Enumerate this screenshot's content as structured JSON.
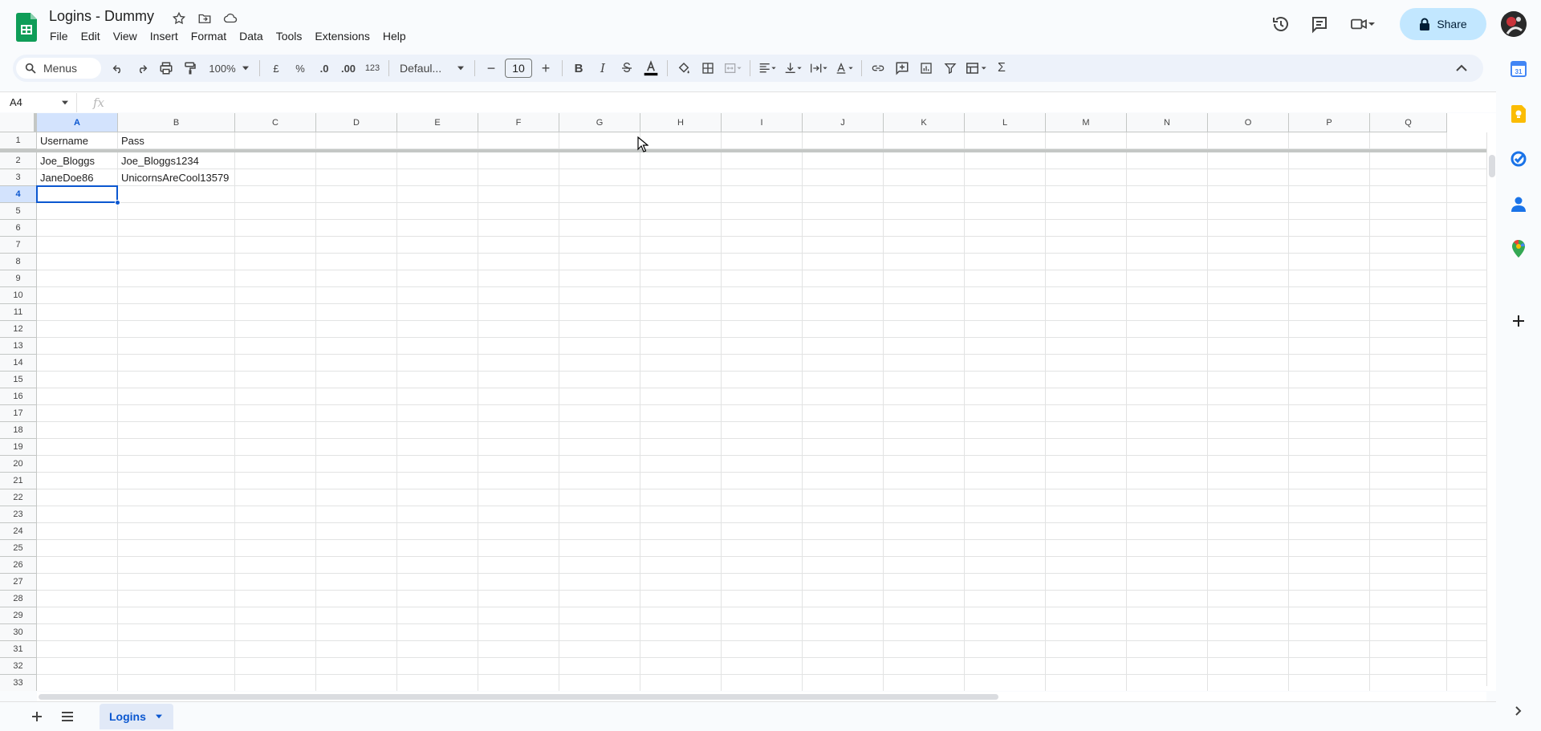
{
  "app": {
    "title": "Logins - Dummy",
    "menus": [
      "File",
      "Edit",
      "View",
      "Insert",
      "Format",
      "Data",
      "Tools",
      "Extensions",
      "Help"
    ],
    "share_label": "Share"
  },
  "toolbar": {
    "search_label": "Menus",
    "zoom": "100%",
    "currency": "£",
    "percent": "%",
    "decrease_decimal": ".0",
    "increase_decimal": ".00",
    "number_format": "123",
    "font": "Defaul...",
    "font_size": "10",
    "bold": "B",
    "italic": "I",
    "sum": "Σ"
  },
  "formula_bar": {
    "cell_ref": "A4",
    "fx": "fx",
    "value": ""
  },
  "sheet": {
    "columns": [
      "A",
      "B",
      "C",
      "D",
      "E",
      "F",
      "G",
      "H",
      "I",
      "J",
      "K",
      "L",
      "M",
      "N",
      "O",
      "P",
      "Q"
    ],
    "active_column": "A",
    "active_row": "4",
    "rows": [
      "1",
      "2",
      "3",
      "4",
      "5",
      "6",
      "7",
      "8",
      "9",
      "10",
      "11",
      "12",
      "13",
      "14",
      "15",
      "16",
      "17",
      "18",
      "19",
      "20",
      "21",
      "22",
      "23",
      "24",
      "25",
      "26",
      "27",
      "28",
      "29",
      "30",
      "31",
      "32",
      "33"
    ],
    "cells": {
      "A1": "Username",
      "B1": "Pass",
      "A2": "Joe_Bloggs",
      "B2": "Joe_Bloggs1234",
      "A3": "JaneDoe86",
      "B3": "UnicornsAreCool13579"
    }
  },
  "tabs": [
    {
      "label": "Logins",
      "active": true
    }
  ],
  "side_panel": {
    "calendar_day": "31"
  },
  "colors": {
    "accent": "#0b57d0",
    "share_bg": "#c2e7ff",
    "sheets_green": "#0f9d58"
  }
}
